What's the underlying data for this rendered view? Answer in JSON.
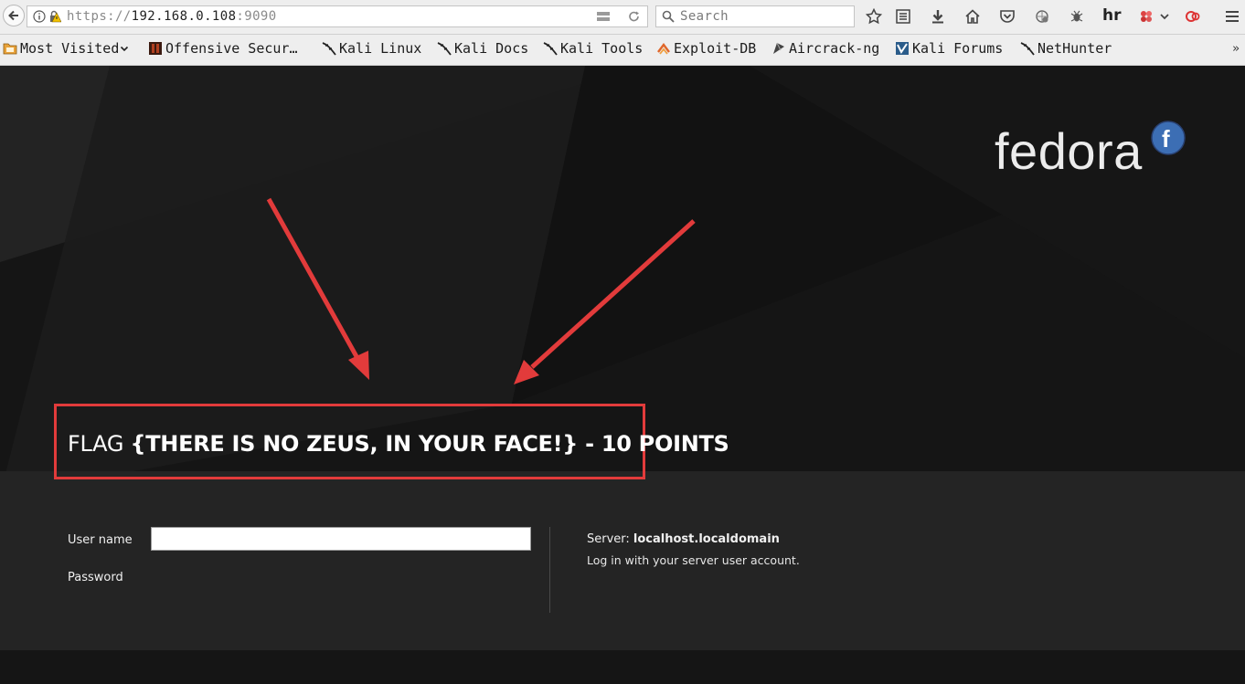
{
  "browser": {
    "url_scheme": "https://",
    "url_host": "192.168.0.108",
    "url_port": ":9090",
    "search_placeholder": "Search",
    "toolbar_icons": [
      "star-icon",
      "reading-list-icon",
      "download-icon",
      "home-icon",
      "pocket-icon",
      "extension-icon",
      "bug-icon",
      "hackerrank-icon",
      "addon-icon",
      "chevron-down-icon",
      "red-circle-icon",
      "menu-icon"
    ],
    "hackerrank_label": "hr",
    "bookmarks": [
      {
        "label": "Most Visited",
        "icon": "folder-icon"
      },
      {
        "label": "Offensive Secur…",
        "icon": "offsec-icon"
      },
      {
        "label": "Kali Linux",
        "icon": "kali-dragon-icon"
      },
      {
        "label": "Kali Docs",
        "icon": "kali-dragon-icon"
      },
      {
        "label": "Kali Tools",
        "icon": "kali-dragon-icon"
      },
      {
        "label": "Exploit-DB",
        "icon": "exploitdb-icon"
      },
      {
        "label": "Aircrack-ng",
        "icon": "aircrack-icon"
      },
      {
        "label": "Kali Forums",
        "icon": "forums-icon"
      },
      {
        "label": "NetHunter",
        "icon": "kali-dragon-icon"
      }
    ],
    "overflow": "»"
  },
  "page": {
    "brand": "fedora",
    "brand_mark": "f",
    "flag_prefix": "FLAG ",
    "flag_value": "{THERE IS NO ZEUS, IN YOUR FACE!} - 10 POINTS",
    "login": {
      "username_label": "User name",
      "username_value": "",
      "password_label": "Password",
      "server_label": "Server: ",
      "server_name": "localhost.localdomain",
      "hint": "Log in with your server user account."
    }
  },
  "colors": {
    "annotation": "#e23b3b",
    "page_bg": "#151515",
    "panel_bg": "#242424",
    "fedora_blue": "#3c6eb4"
  }
}
